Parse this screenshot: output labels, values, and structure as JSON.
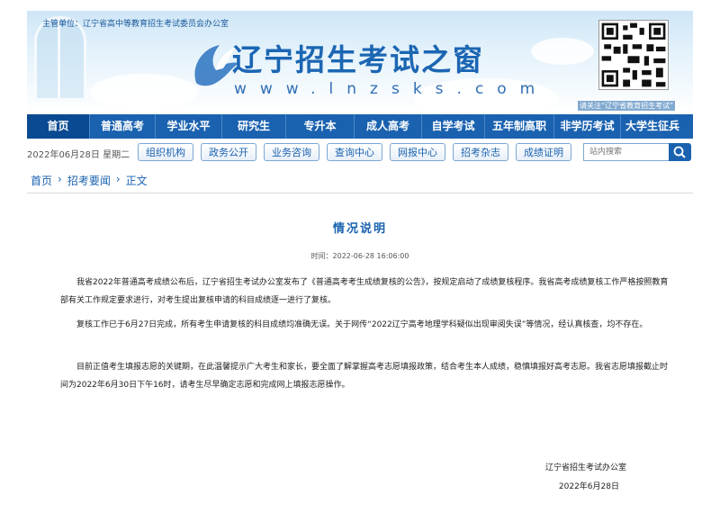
{
  "header": {
    "sponsor": "主管单位：辽宁省高中等教育招生考试委员会办公室",
    "title": "辽宁招生考试之窗",
    "domain": "www.lnzsks.com",
    "qr_caption": "请关注“辽宁省教育招生考试”"
  },
  "nav": {
    "items": [
      "首页",
      "普通高考",
      "学业水平",
      "研究生",
      "专升本",
      "成人高考",
      "自学考试",
      "五年制高职",
      "非学历考试",
      "大学生征兵"
    ]
  },
  "subbar": {
    "date": "2022年06月28日 星期二",
    "buttons": [
      "组织机构",
      "政务公开",
      "业务咨询",
      "查询中心",
      "网报中心",
      "招考杂志",
      "成绩证明"
    ],
    "search_placeholder": "站内搜索"
  },
  "breadcrumb": {
    "items": [
      "首页",
      "招考要闻",
      "正文"
    ],
    "separator": "›"
  },
  "article": {
    "title": "情况说明",
    "time": "时间：2022-06-28 16:06:00",
    "paragraphs": [
      "我省2022年普通高考成绩公布后，辽宁省招生考试办公室发布了《普通高考考生成绩复核的公告》，按规定启动了成绩复核程序。我省高考成绩复核工作严格按照教育部有关工作规定要求进行，对考生提出复核申请的科目成绩逐一进行了复核。",
      "复核工作已于6月27日完成，所有考生申请复核的科目成绩均准确无误。关于网传“2022辽宁高考地理学科疑似出现审阅失误”等情况，经认真核查，均不存在。",
      "目前正值考生填报志愿的关键期，在此温馨提示广大考生和家长，要全面了解掌握高考志愿填报政策，结合考生本人成绩，稳慎填报好高考志愿。我省志愿填报截止时间为2022年6月30日下午16时，请考生尽早确定志愿和完成网上填报志愿操作。"
    ],
    "signature": "辽宁省招生考试办公室",
    "sign_date": "2022年6月28日"
  },
  "colors": {
    "brand": "#1a62b0",
    "nav_active": "#0a4a92"
  }
}
